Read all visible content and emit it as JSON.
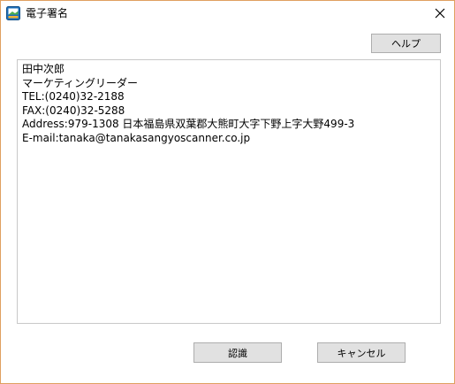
{
  "window": {
    "title": "電子署名",
    "app_icon": "app-icon",
    "close_icon": "close-icon",
    "accent_color": "#e0a060"
  },
  "toolbar": {
    "help_label": "ヘルプ"
  },
  "signature": {
    "lines": [
      "田中次郎",
      "マーケティングリーダー",
      "TEL:(0240)32-2188",
      "FAX:(0240)32-5288",
      "Address:979-1308 日本福島県双葉郡大熊町大字下野上字大野499-3",
      "E-mail:tanaka@tanakasangyoscanner.co.jp"
    ]
  },
  "footer": {
    "recognize_label": "認識",
    "cancel_label": "キャンセル"
  }
}
